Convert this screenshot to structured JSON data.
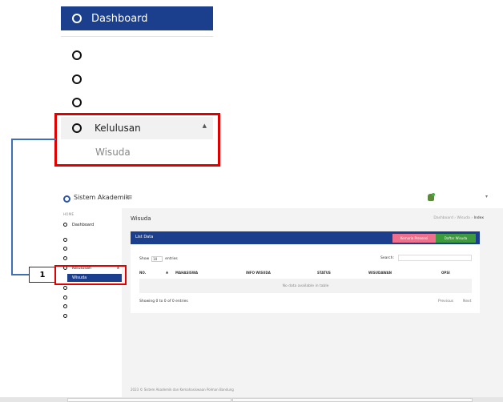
{
  "zoom": {
    "dashboard_label": "Dashboard",
    "kelulusan_label": "Kelulusan",
    "caret": "▲",
    "wisuda_label": "Wisuda"
  },
  "callout_number": "1",
  "app": {
    "brand": "Sistem Akademik",
    "hamburger": "≡",
    "user_caret": "▾",
    "sidebar": {
      "section_label": "HOME",
      "items": [
        {
          "label": "Dashboard"
        },
        {
          "label": ""
        },
        {
          "label": ""
        },
        {
          "label": ""
        },
        {
          "label": "Kelulusan"
        },
        {
          "label": ""
        },
        {
          "label": ""
        },
        {
          "label": ""
        },
        {
          "label": ""
        }
      ],
      "active_sub_label": "Wisuda",
      "caret": "▲"
    },
    "content": {
      "page_title": "Wisuda",
      "breadcrumb": [
        "Dashboard",
        "Wisuda",
        "Index"
      ],
      "breadcrumb_sep": "›",
      "card": {
        "title": "List Data",
        "btn_pink": "Kemaria Presensi",
        "btn_green": "Daftar Wisuda",
        "show_label": "Show",
        "show_value": "10",
        "entries_label": "entries",
        "search_label": "Search:",
        "columns": [
          "NO.",
          "MAHASISWA",
          "INFO WISUDA",
          "STATUS",
          "WISUDAWAN",
          "OPSI"
        ],
        "sort_icon": "▲",
        "empty_text": "No data available in table",
        "info_text": "Showing 0 to 0 of 0 entries",
        "prev_label": "Previous",
        "next_label": "Next"
      },
      "footer": "2023 © Sistem Akademik dan Kemahasiswaan Polman Bandung"
    }
  },
  "colors": {
    "primary": "#1b3f8c",
    "highlight_border": "#e00000",
    "connector": "#3f6fb6",
    "btn_pink": "#ef6f8c",
    "btn_green": "#3d9a3d"
  }
}
